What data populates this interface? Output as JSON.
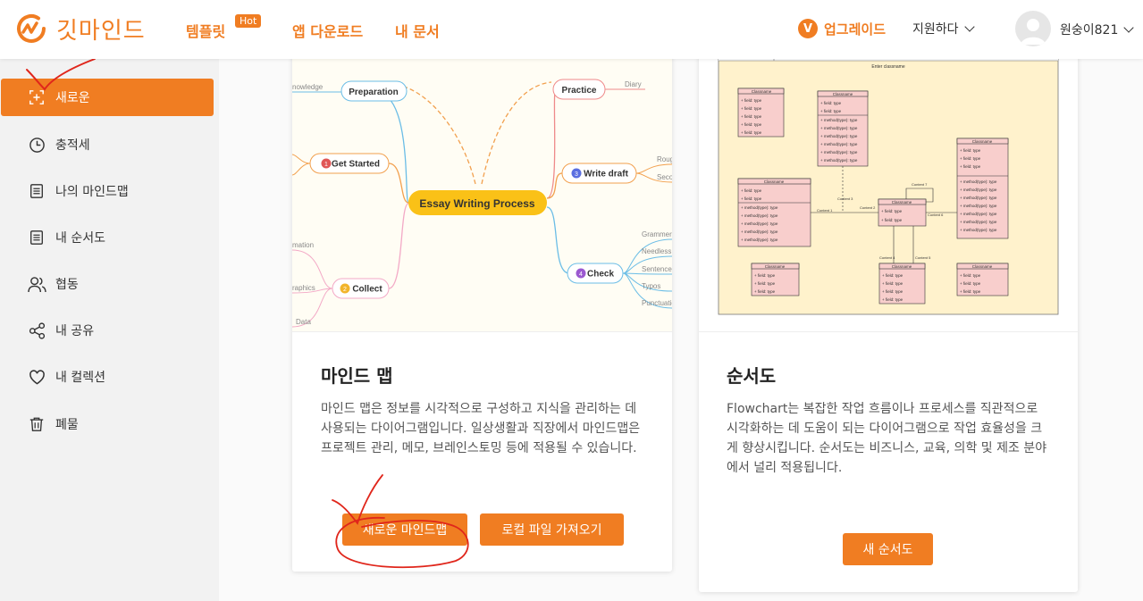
{
  "header": {
    "logo_text": "깃마인드",
    "nav": [
      {
        "label": "템플릿",
        "badge": "Hot"
      },
      {
        "label": "앱 다운로드"
      },
      {
        "label": "내 문서"
      }
    ],
    "upgrade_label": "업그레이드",
    "upgrade_icon_glyph": "V",
    "support_label": "지원하다",
    "username": "원숭이821"
  },
  "sidebar": {
    "items": [
      {
        "label": "새로운",
        "icon": "plus-square-icon",
        "active": true
      },
      {
        "label": "충적세",
        "icon": "clock-icon"
      },
      {
        "label": "나의 마인드맵",
        "icon": "document-icon"
      },
      {
        "label": "내 순서도",
        "icon": "document-icon"
      },
      {
        "label": "협동",
        "icon": "users-icon"
      },
      {
        "label": "내 공유",
        "icon": "share-icon"
      },
      {
        "label": "내 컬렉션",
        "icon": "heart-icon"
      },
      {
        "label": "폐물",
        "icon": "trash-icon"
      }
    ]
  },
  "cards": [
    {
      "title": "마인드 맵",
      "description": "마인드 맵은 정보를 시각적으로 구성하고 지식을 관리하는 데 사용되는 다이어그램입니다. 일상생활과 직장에서 마인드맵은 프로젝트 관리, 메모, 브레인스토밍 등에 적용될 수 있습니다.",
      "buttons": [
        "새로운 마인드맵",
        "로컬 파일 가져오기"
      ],
      "preview": {
        "center": "Essay Writing Process",
        "nodes": [
          "Preparation",
          "Get Started",
          "Collect",
          "Practice",
          "Write draft",
          "Check"
        ],
        "node_numbers": [
          "1",
          "2",
          "3",
          "4"
        ],
        "leaves": [
          "nowledge",
          "mation",
          "raphics",
          "Data",
          "Diary",
          "Roug",
          "Seco",
          "Grammer",
          "Needless",
          "Sentence",
          "Typos",
          "Punctuatio"
        ]
      }
    },
    {
      "title": "순서도",
      "description": "Flowchart는 복잡한 작업 흐름이나 프로세스를 직관적으로 시각화하는 데 도움이 되는 다이어그램으로 작업 효율성을 크게 향상시킵니다. 순서도는 비즈니스, 교육, 의학 및 제조 분야에서 널리 적용됩니다.",
      "buttons": [
        "새 순서도"
      ],
      "preview": {
        "caption": "Enter classname",
        "class_label": "Classname",
        "field_label": "+ field: type",
        "method_label": "+ method(type): type",
        "connectors": [
          "Content 1",
          "Content 2",
          "Content 3",
          "Content 4",
          "Content 5",
          "Content 6",
          "Content 7"
        ]
      }
    }
  ],
  "colors": {
    "accent": "#f07d22",
    "annotation": "#e0261b"
  }
}
